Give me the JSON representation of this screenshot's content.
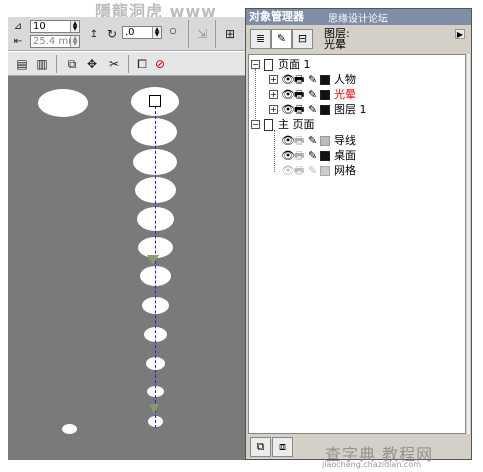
{
  "watermarks": {
    "top": "隱龍洞虎 www",
    "top_right": "思缘设计论坛 www.MISSYUAN.COM",
    "bottom": "查字典 教程网",
    "bottom_url": "jiaocheng.chazidian.com"
  },
  "property_bar": {
    "size_value": "10",
    "width_value": "25.4 mm",
    "angle_value": ".0"
  },
  "docker": {
    "title": "对象管理器",
    "current_layer_label": "图层:",
    "current_layer_value": "光晕",
    "tree": {
      "page1": "页面 1",
      "layer_people": "人物",
      "layer_glow": "光晕",
      "layer_1": "图层 1",
      "master_page": "主 页面",
      "guides": "导线",
      "desktop": "桌面",
      "grid": "网格"
    }
  },
  "colors": {
    "canvas": "#7a7a7a",
    "active_layer_text": "#ff0000",
    "guide_line": "#1a1aff",
    "titlebar": "#7e8ea8"
  }
}
